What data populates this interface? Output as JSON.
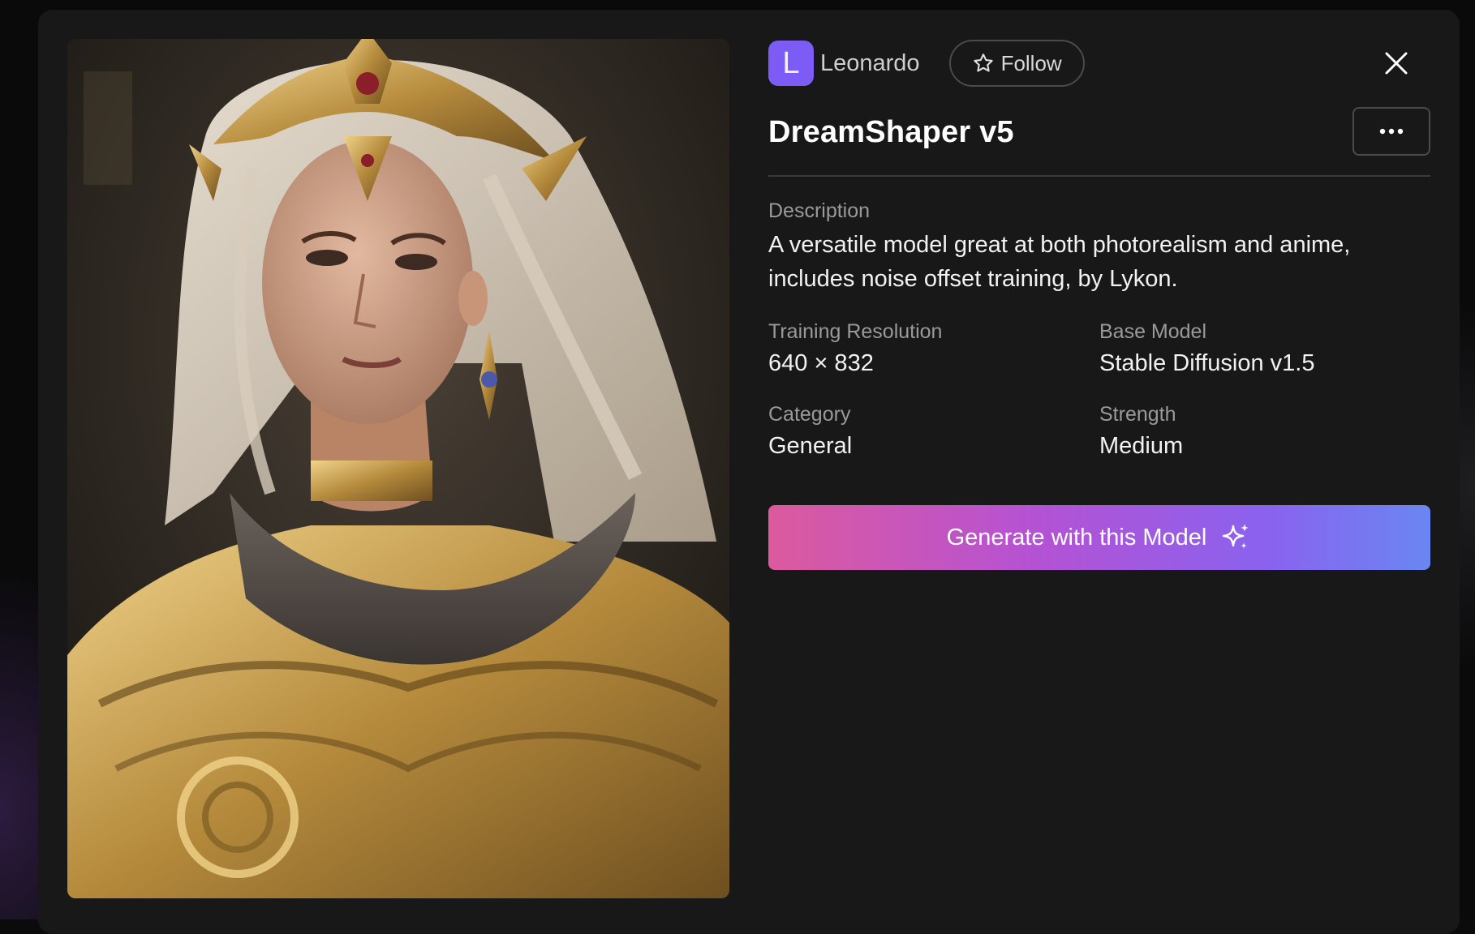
{
  "creator": {
    "avatar_letter": "L",
    "name": "Leonardo",
    "follow_label": "Follow"
  },
  "model": {
    "title": "DreamShaper v5",
    "description_label": "Description",
    "description": "A versatile model great at both photorealism and anime, includes noise offset training, by Lykon."
  },
  "details": {
    "training_resolution_label": "Training Resolution",
    "training_resolution": "640 × 832",
    "base_model_label": "Base Model",
    "base_model": "Stable Diffusion v1.5",
    "category_label": "Category",
    "category": "General",
    "strength_label": "Strength",
    "strength": "Medium"
  },
  "actions": {
    "generate_label": "Generate with this Model"
  },
  "icons": {
    "follow": "star-icon",
    "close": "close-icon",
    "more": "more-horizontal-icon",
    "generate": "sparkles-icon"
  },
  "colors": {
    "avatar": "#7c5cf5",
    "modal_background": "#181818",
    "generate_gradient": [
      "#dc5a9e",
      "#b552d4",
      "#8a62ee",
      "#6a86f2"
    ]
  }
}
